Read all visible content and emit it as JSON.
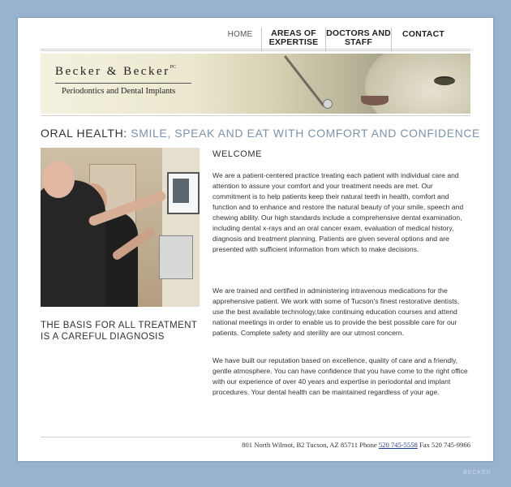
{
  "nav": {
    "home": "HOME",
    "areas": "AREAS of EXPERTISE",
    "doctors": "DOCTORS and STAFF",
    "contact": "CONTACT"
  },
  "banner": {
    "logo_name": "Becker & Becker",
    "logo_pc": "PC",
    "logo_subtitle": "Periodontics and Dental Implants"
  },
  "headline": {
    "lead": "Oral Health: ",
    "tail": "Smile, Speak and Eat with Comfort and Confidence"
  },
  "photo_caption": {
    "line1": "The Basis for All Treatment",
    "line2": "is a Careful Diagnosis"
  },
  "main": {
    "welcome": "Welcome",
    "paragraphs": [
      "We are a patient-centered practice treating each patient with individual care and attention to assure your comfort and your treatment needs are met. Our commitment is to help patients keep their natural teeth in health, comfort and function and to enhance and restore the natural beauty of your smile, speech and chewing ability. Our high standards include a comprehensive dental examination, including dental x-rays and an oral cancer exam, evaluation of medical history, diagnosis and treatment planning. Patients are given several options and are presented with sufficient information from which to make decisions.",
      "We are trained and certified in administering intravenous medications for the apprehensive patient. We work with some of Tucson's finest restorative dentists, use the best available technology,take continuing education courses and attend national meetings in order to enable us to provide the best possible care for our patients. Complete safety and sterility are our utmost concern.",
      "We have built our reputation based on excellence, quality of care and a friendly, gentle atmosphere. You can have confidence that you have come to the right office with our experience of over 40 years and expertise in periodontal and implant procedures. Your dental health can be maintained regardless of your age."
    ]
  },
  "footer": {
    "address": "801 North Wilmot, B2   Tucson, AZ 85711   Phone ",
    "phone": "520 745-5558",
    "fax": "   Fax 520 745-9966"
  },
  "corner_mark": "BECKER"
}
